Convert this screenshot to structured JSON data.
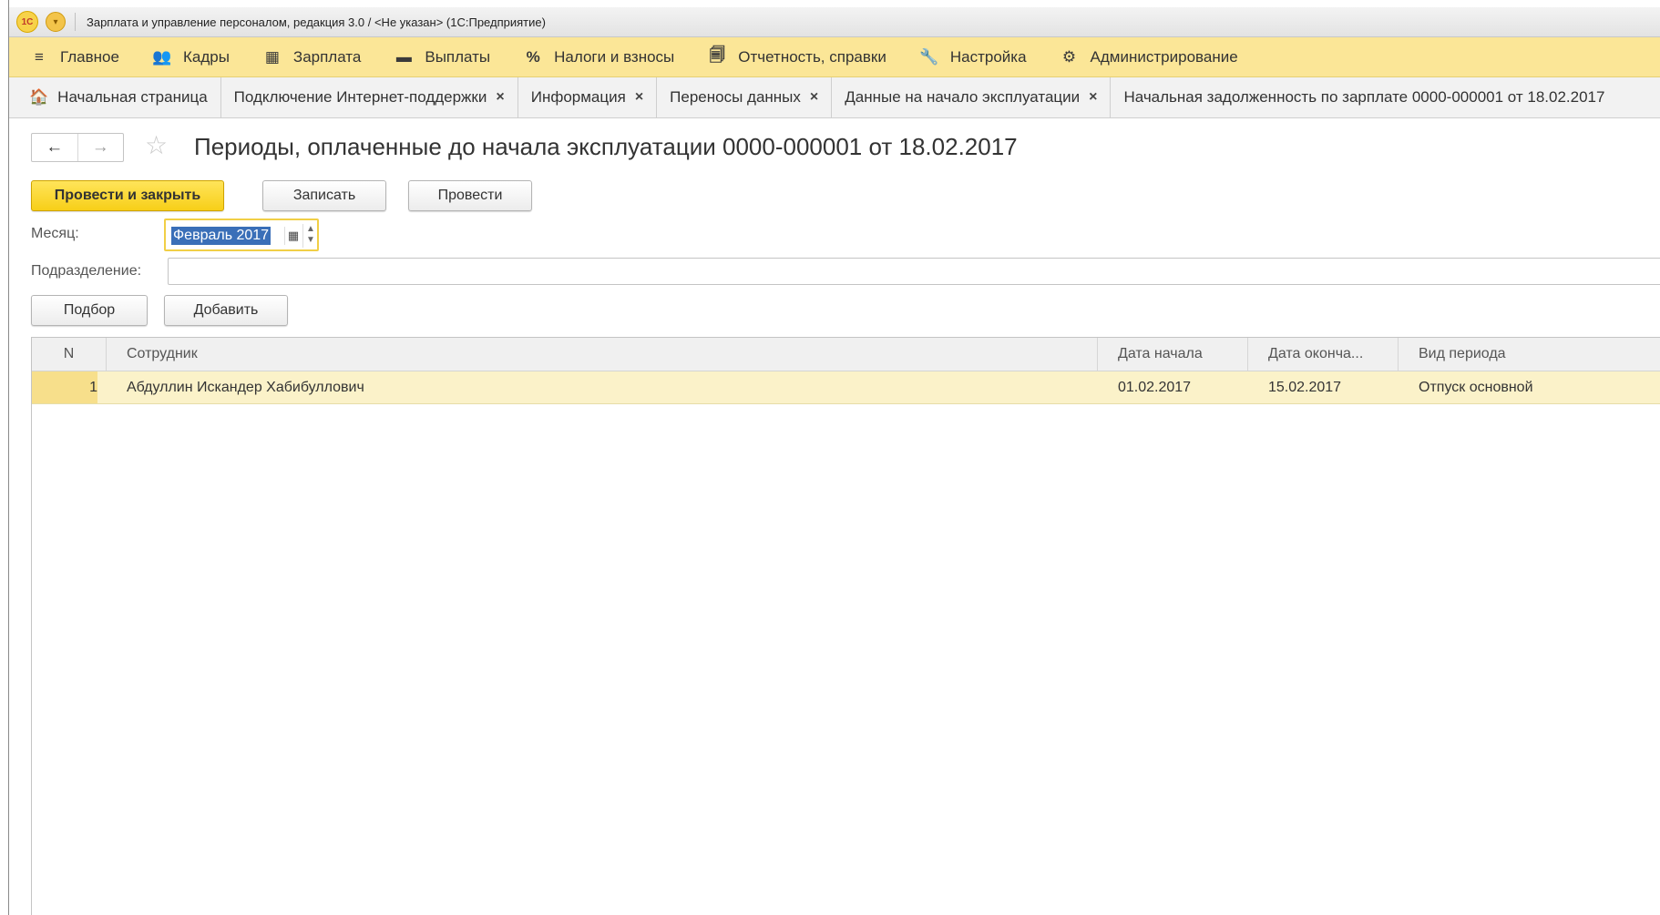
{
  "titlebar": {
    "logo": "1С",
    "menu_icon": "▾",
    "title": "Зарплата и управление персоналом, редакция 3.0 / <Не указан>  (1С:Предприятие)"
  },
  "main_menu": [
    {
      "icon": "≡",
      "icon_name": "hamburger-icon",
      "label": "Главное"
    },
    {
      "icon": "👥",
      "icon_name": "people-icon",
      "label": "Кадры"
    },
    {
      "icon": "▦",
      "icon_name": "calculator-icon",
      "label": "Зарплата"
    },
    {
      "icon": "▬",
      "icon_name": "wallet-icon",
      "label": "Выплаты"
    },
    {
      "icon": "%",
      "icon_name": "percent-icon",
      "label": "Налоги и взносы"
    },
    {
      "icon": "🗐",
      "icon_name": "documents-icon",
      "label": "Отчетность, справки"
    },
    {
      "icon": "🔧",
      "icon_name": "wrench-icon",
      "label": "Настройка"
    },
    {
      "icon": "⚙",
      "icon_name": "gear-icon",
      "label": "Администрирование"
    }
  ],
  "tabs": [
    {
      "label": "Начальная страница",
      "home_icon": "🏠",
      "closable": false
    },
    {
      "label": "Подключение Интернет-поддержки",
      "close": "×",
      "closable": true
    },
    {
      "label": "Информация",
      "close": "×",
      "closable": true
    },
    {
      "label": "Переносы данных",
      "close": "×",
      "closable": true
    },
    {
      "label": "Данные на начало эксплуатации",
      "close": "×",
      "closable": true
    },
    {
      "label": "Начальная задолженность по зарплате 0000-000001 от 18.02.2017",
      "closable": false
    }
  ],
  "nav": {
    "back": "←",
    "forward": "→",
    "star": "☆"
  },
  "document": {
    "title": "Периоды, оплаченные до начала эксплуатации 0000-000001 от 18.02.2017"
  },
  "toolbar": {
    "post_close": "Провести и закрыть",
    "save": "Записать",
    "post": "Провести"
  },
  "form": {
    "month_label": "Месяц:",
    "month_value": "Февраль 2017",
    "calendar_icon": "▦",
    "spin_up": "▲",
    "spin_down": "▼",
    "subdivision_label": "Подразделение:",
    "subdivision_value": ""
  },
  "table_toolbar": {
    "pick": "Подбор",
    "add": "Добавить"
  },
  "table": {
    "headers": [
      "N",
      "Сотрудник",
      "Дата начала",
      "Дата оконча...",
      "Вид периода"
    ],
    "rows": [
      [
        "1",
        "Абдуллин Искандер Хабибуллович",
        "01.02.2017",
        "15.02.2017",
        "Отпуск основной"
      ]
    ]
  },
  "colors": {
    "menu_bg": "#fbe697",
    "primary_button": "#f7cf18",
    "selected_row": "#fbf2c9",
    "selection_highlight": "#3a6fb8"
  }
}
